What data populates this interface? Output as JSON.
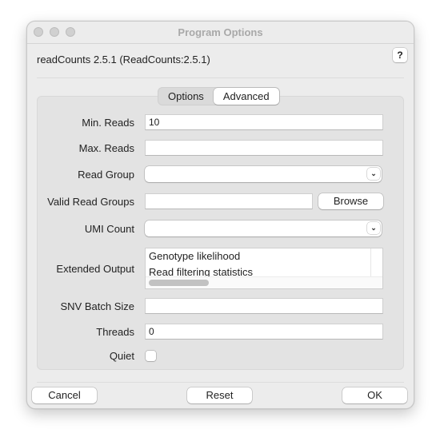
{
  "window": {
    "title": "Program Options",
    "header": "readCounts 2.5.1 (ReadCounts:2.5.1)",
    "help_label": "?"
  },
  "tabs": [
    {
      "label": "Options",
      "active": false
    },
    {
      "label": "Advanced",
      "active": true
    }
  ],
  "fields": {
    "min_reads": {
      "label": "Min. Reads",
      "value": "10"
    },
    "max_reads": {
      "label": "Max. Reads",
      "value": ""
    },
    "read_group": {
      "label": "Read Group",
      "value": ""
    },
    "valid_read_groups": {
      "label": "Valid Read Groups",
      "value": "",
      "browse_label": "Browse"
    },
    "umi_count": {
      "label": "UMI Count",
      "value": ""
    },
    "extended_output": {
      "label": "Extended Output",
      "items": [
        "Genotype likelihood",
        "Read filtering statistics"
      ]
    },
    "snv_batch_size": {
      "label": "SNV Batch Size",
      "value": ""
    },
    "threads": {
      "label": "Threads",
      "value": "0"
    },
    "quiet": {
      "label": "Quiet",
      "checked": false
    }
  },
  "footer": {
    "cancel_label": "Cancel",
    "reset_label": "Reset",
    "ok_label": "OK"
  }
}
